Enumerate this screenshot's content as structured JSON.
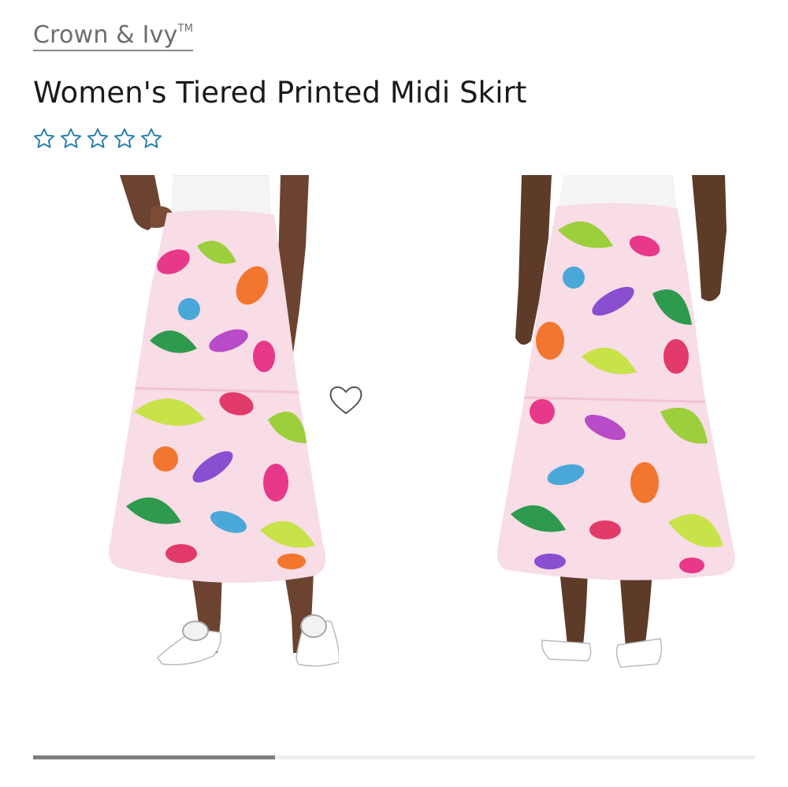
{
  "product": {
    "brand": "Crown & Ivy",
    "brand_trademark": "TM",
    "title": "Women's Tiered Printed Midi Skirt",
    "rating": {
      "value": 0,
      "max": 5,
      "star_icon": "star-outline-icon"
    }
  },
  "gallery": {
    "images": [
      {
        "name": "front-view"
      },
      {
        "name": "back-view"
      }
    ],
    "favorite_icon": "heart-outline-icon",
    "scroll_progress": 0.335
  },
  "colors": {
    "brand_text": "#6d6d6d",
    "title_text": "#1a1a1a",
    "star_outline": "#1e7ba8",
    "heart_outline": "#555555",
    "progress_fill": "#7d7d7d",
    "progress_track": "#eeeeee",
    "skirt_base": "#f8dce6"
  }
}
